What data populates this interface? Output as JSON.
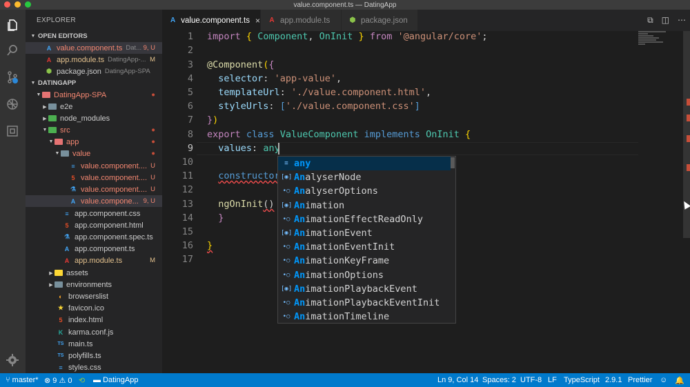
{
  "window": {
    "title": "value.component.ts — DatingApp"
  },
  "activity_bar": {
    "icons": [
      "files-icon",
      "search-icon",
      "source-control-icon",
      "debug-icon",
      "extensions-icon",
      "gear-icon"
    ]
  },
  "sidebar": {
    "title": "EXPLORER",
    "open_editors_header": "OPEN EDITORS",
    "open_editors": [
      {
        "name": "value.component.ts",
        "desc": "Dat...",
        "badge": "9, U"
      },
      {
        "name": "app.module.ts",
        "desc": "DatingApp-...",
        "badge": "M"
      },
      {
        "name": "package.json",
        "desc": "DatingApp-SPA",
        "badge": ""
      }
    ],
    "project_header": "DATINGAPP",
    "tree": [
      {
        "name": "DatingApp-SPA",
        "badge": "●"
      },
      {
        "name": "e2e",
        "badge": ""
      },
      {
        "name": "node_modules",
        "badge": ""
      },
      {
        "name": "src",
        "badge": "●"
      },
      {
        "name": "app",
        "badge": "●"
      },
      {
        "name": "value",
        "badge": "●"
      },
      {
        "name": "value.component....",
        "badge": "U"
      },
      {
        "name": "value.component....",
        "badge": "U"
      },
      {
        "name": "value.component....",
        "badge": "U"
      },
      {
        "name": "value.compone...",
        "badge": "9, U"
      },
      {
        "name": "app.component.css",
        "badge": ""
      },
      {
        "name": "app.component.html",
        "badge": ""
      },
      {
        "name": "app.component.spec.ts",
        "badge": ""
      },
      {
        "name": "app.component.ts",
        "badge": ""
      },
      {
        "name": "app.module.ts",
        "badge": "M"
      },
      {
        "name": "assets",
        "badge": ""
      },
      {
        "name": "environments",
        "badge": ""
      },
      {
        "name": "browserslist",
        "badge": ""
      },
      {
        "name": "favicon.ico",
        "badge": ""
      },
      {
        "name": "index.html",
        "badge": ""
      },
      {
        "name": "karma.conf.js",
        "badge": ""
      },
      {
        "name": "main.ts",
        "badge": ""
      },
      {
        "name": "polyfills.ts",
        "badge": ""
      },
      {
        "name": "styles.css",
        "badge": ""
      }
    ]
  },
  "tabs": [
    {
      "label": "value.component.ts",
      "close": "×"
    },
    {
      "label": "app.module.ts"
    },
    {
      "label": "package.json"
    }
  ],
  "editor": {
    "line_numbers": [
      "1",
      "2",
      "3",
      "4",
      "5",
      "6",
      "7",
      "8",
      "9",
      "10",
      "11",
      "12",
      "13",
      "14",
      "15",
      "16",
      "17"
    ],
    "current_line": 9,
    "lines": {
      "l1": {
        "import": "import",
        "ob": "{",
        "c1": " Component",
        "comma": ",",
        "c2": " OnInit",
        "cb": "}",
        "from": "from",
        "mod": "'@angular/core'",
        "semi": ";"
      },
      "l3": {
        "at": "@Component",
        "po": "(",
        "bo": "{"
      },
      "l4": {
        "key": "selector",
        "colon": ": ",
        "val": "'app-value'",
        "comma": ","
      },
      "l5": {
        "key": "templateUrl",
        "colon": ": ",
        "val": "'./value.component.html'",
        "comma": ","
      },
      "l6": {
        "key": "styleUrls",
        "colon": ": ",
        "bo": "[",
        "val": "'./value.component.css'",
        "bc": "]"
      },
      "l7": {
        "bc": "}",
        "pc": ")"
      },
      "l8": {
        "export": "export",
        "class": "class",
        "name": "ValueComponent",
        "implements": "implements",
        "iface": "OnInit",
        "bo": "{"
      },
      "l9": {
        "key": "values",
        "colon": ": ",
        "val": "any"
      },
      "l11": {
        "text": "constructor"
      },
      "l13": {
        "fn": "ngOnInit",
        "parens": "()"
      },
      "l14": {
        "bc": "}"
      },
      "l16": {
        "bc": "}"
      }
    }
  },
  "suggest": {
    "items": [
      {
        "hl": "any",
        "rest": "",
        "icon": "keyword-icon"
      },
      {
        "hl": "An",
        "rest": "alyserNode",
        "icon": "interface-icon"
      },
      {
        "hl": "An",
        "rest": "alyserOptions",
        "icon": "property-icon"
      },
      {
        "hl": "An",
        "rest": "imation",
        "icon": "interface-icon"
      },
      {
        "hl": "An",
        "rest": "imationEffectReadOnly",
        "icon": "property-icon"
      },
      {
        "hl": "An",
        "rest": "imationEvent",
        "icon": "interface-icon"
      },
      {
        "hl": "An",
        "rest": "imationEventInit",
        "icon": "property-icon"
      },
      {
        "hl": "An",
        "rest": "imationKeyFrame",
        "icon": "property-icon"
      },
      {
        "hl": "An",
        "rest": "imationOptions",
        "icon": "property-icon"
      },
      {
        "hl": "An",
        "rest": "imationPlaybackEvent",
        "icon": "interface-icon"
      },
      {
        "hl": "An",
        "rest": "imationPlaybackEventInit",
        "icon": "property-icon"
      },
      {
        "hl": "An",
        "rest": "imationTimeline",
        "icon": "property-icon"
      }
    ]
  },
  "statusbar": {
    "branch": "master*",
    "errors": "9",
    "warnings": "0",
    "folder": "DatingApp",
    "position": "Ln 9, Col 14",
    "spaces": "Spaces: 2",
    "encoding": "UTF-8",
    "eol": "LF",
    "language": "TypeScript",
    "version": "2.9.1",
    "formatter": "Prettier"
  },
  "colors": {
    "accent": "#007acc",
    "editor_bg": "#1e1e1e",
    "sidebar_bg": "#252526",
    "modified": "#e2c08d",
    "untracked": "#f48771"
  }
}
